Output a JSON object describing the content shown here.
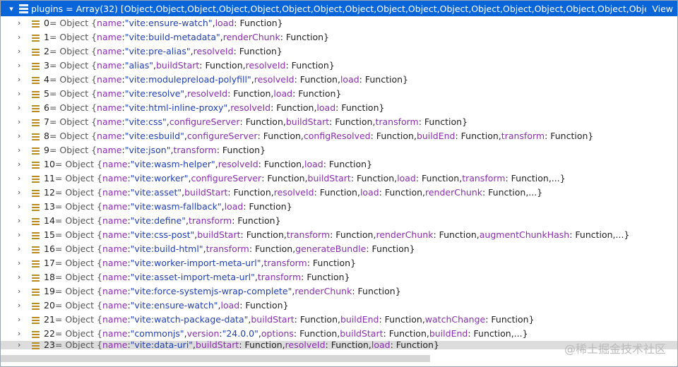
{
  "header": {
    "text": "plugins = Array(32) [Object,Object,Object,Object,Object,Object,Object,Object,Object,Object,Object,Object,Object,Object,Object,Object,Object,Object,Object,Ol...",
    "view_label": "View"
  },
  "rows": [
    {
      "index": "0",
      "parts": [
        [
          "p",
          "name"
        ],
        [
          "k",
          ": "
        ],
        [
          "s",
          "\"vite:ensure-watch\""
        ],
        [
          "k",
          ","
        ],
        [
          "p",
          "load"
        ],
        [
          "f",
          ": Function}"
        ]
      ]
    },
    {
      "index": "1",
      "parts": [
        [
          "p",
          "name"
        ],
        [
          "k",
          ": "
        ],
        [
          "s",
          "\"vite:build-metadata\""
        ],
        [
          "k",
          ","
        ],
        [
          "p",
          "renderChunk"
        ],
        [
          "f",
          ": Function}"
        ]
      ]
    },
    {
      "index": "2",
      "parts": [
        [
          "p",
          "name"
        ],
        [
          "k",
          ": "
        ],
        [
          "s",
          "\"vite:pre-alias\""
        ],
        [
          "k",
          ","
        ],
        [
          "p",
          "resolveId"
        ],
        [
          "f",
          ": Function}"
        ]
      ]
    },
    {
      "index": "3",
      "parts": [
        [
          "p",
          "name"
        ],
        [
          "k",
          ": "
        ],
        [
          "s",
          "\"alias\""
        ],
        [
          "k",
          ","
        ],
        [
          "p",
          "buildStart"
        ],
        [
          "f",
          ": Function,"
        ],
        [
          "p",
          "resolveId"
        ],
        [
          "f",
          ": Function}"
        ]
      ]
    },
    {
      "index": "4",
      "parts": [
        [
          "p",
          "name"
        ],
        [
          "k",
          ": "
        ],
        [
          "s",
          "\"vite:modulepreload-polyfill\""
        ],
        [
          "k",
          ","
        ],
        [
          "p",
          "resolveId"
        ],
        [
          "f",
          ": Function,"
        ],
        [
          "p",
          "load"
        ],
        [
          "f",
          ": Function}"
        ]
      ]
    },
    {
      "index": "5",
      "parts": [
        [
          "p",
          "name"
        ],
        [
          "k",
          ": "
        ],
        [
          "s",
          "\"vite:resolve\""
        ],
        [
          "k",
          ","
        ],
        [
          "p",
          "resolveId"
        ],
        [
          "f",
          ": Function,"
        ],
        [
          "p",
          "load"
        ],
        [
          "f",
          ": Function}"
        ]
      ]
    },
    {
      "index": "6",
      "parts": [
        [
          "p",
          "name"
        ],
        [
          "k",
          ": "
        ],
        [
          "s",
          "\"vite:html-inline-proxy\""
        ],
        [
          "k",
          ","
        ],
        [
          "p",
          "resolveId"
        ],
        [
          "f",
          ": Function,"
        ],
        [
          "p",
          "load"
        ],
        [
          "f",
          ": Function}"
        ]
      ]
    },
    {
      "index": "7",
      "parts": [
        [
          "p",
          "name"
        ],
        [
          "k",
          ": "
        ],
        [
          "s",
          "\"vite:css\""
        ],
        [
          "k",
          ","
        ],
        [
          "p",
          "configureServer"
        ],
        [
          "f",
          ": Function,"
        ],
        [
          "p",
          "buildStart"
        ],
        [
          "f",
          ": Function,"
        ],
        [
          "p",
          "transform"
        ],
        [
          "f",
          ": Function}"
        ]
      ]
    },
    {
      "index": "8",
      "parts": [
        [
          "p",
          "name"
        ],
        [
          "k",
          ": "
        ],
        [
          "s",
          "\"vite:esbuild\""
        ],
        [
          "k",
          ","
        ],
        [
          "p",
          "configureServer"
        ],
        [
          "f",
          ": Function,"
        ],
        [
          "p",
          "configResolved"
        ],
        [
          "f",
          ": Function,"
        ],
        [
          "p",
          "buildEnd"
        ],
        [
          "f",
          ": Function,"
        ],
        [
          "p",
          "transform"
        ],
        [
          "f",
          ": Function}"
        ]
      ]
    },
    {
      "index": "9",
      "parts": [
        [
          "p",
          "name"
        ],
        [
          "k",
          ": "
        ],
        [
          "s",
          "\"vite:json\""
        ],
        [
          "k",
          ","
        ],
        [
          "p",
          "transform"
        ],
        [
          "f",
          ": Function}"
        ]
      ]
    },
    {
      "index": "10",
      "parts": [
        [
          "p",
          "name"
        ],
        [
          "k",
          ": "
        ],
        [
          "s",
          "\"vite:wasm-helper\""
        ],
        [
          "k",
          ","
        ],
        [
          "p",
          "resolveId"
        ],
        [
          "f",
          ": Function,"
        ],
        [
          "p",
          "load"
        ],
        [
          "f",
          ": Function}"
        ]
      ]
    },
    {
      "index": "11",
      "parts": [
        [
          "p",
          "name"
        ],
        [
          "k",
          ": "
        ],
        [
          "s",
          "\"vite:worker\""
        ],
        [
          "k",
          ","
        ],
        [
          "p",
          "configureServer"
        ],
        [
          "f",
          ": Function,"
        ],
        [
          "p",
          "buildStart"
        ],
        [
          "f",
          ": Function,"
        ],
        [
          "p",
          "load"
        ],
        [
          "f",
          ": Function,"
        ],
        [
          "p",
          "transform"
        ],
        [
          "f",
          ": Function,...}"
        ]
      ]
    },
    {
      "index": "12",
      "parts": [
        [
          "p",
          "name"
        ],
        [
          "k",
          ": "
        ],
        [
          "s",
          "\"vite:asset\""
        ],
        [
          "k",
          ","
        ],
        [
          "p",
          "buildStart"
        ],
        [
          "f",
          ": Function,"
        ],
        [
          "p",
          "resolveId"
        ],
        [
          "f",
          ": Function,"
        ],
        [
          "p",
          "load"
        ],
        [
          "f",
          ": Function,"
        ],
        [
          "p",
          "renderChunk"
        ],
        [
          "f",
          ": Function,...}"
        ]
      ]
    },
    {
      "index": "13",
      "parts": [
        [
          "p",
          "name"
        ],
        [
          "k",
          ": "
        ],
        [
          "s",
          "\"vite:wasm-fallback\""
        ],
        [
          "k",
          ","
        ],
        [
          "p",
          "load"
        ],
        [
          "f",
          ": Function}"
        ]
      ]
    },
    {
      "index": "14",
      "parts": [
        [
          "p",
          "name"
        ],
        [
          "k",
          ": "
        ],
        [
          "s",
          "\"vite:define\""
        ],
        [
          "k",
          ","
        ],
        [
          "p",
          "transform"
        ],
        [
          "f",
          ": Function}"
        ]
      ]
    },
    {
      "index": "15",
      "parts": [
        [
          "p",
          "name"
        ],
        [
          "k",
          ": "
        ],
        [
          "s",
          "\"vite:css-post\""
        ],
        [
          "k",
          ","
        ],
        [
          "p",
          "buildStart"
        ],
        [
          "f",
          ": Function,"
        ],
        [
          "p",
          "transform"
        ],
        [
          "f",
          ": Function,"
        ],
        [
          "p",
          "renderChunk"
        ],
        [
          "f",
          ": Function,"
        ],
        [
          "p",
          "augmentChunkHash"
        ],
        [
          "f",
          ": Function,...}"
        ]
      ]
    },
    {
      "index": "16",
      "parts": [
        [
          "p",
          "name"
        ],
        [
          "k",
          ": "
        ],
        [
          "s",
          "\"vite:build-html\""
        ],
        [
          "k",
          ","
        ],
        [
          "p",
          "transform"
        ],
        [
          "f",
          ": Function,"
        ],
        [
          "p",
          "generateBundle"
        ],
        [
          "f",
          ": Function}"
        ]
      ]
    },
    {
      "index": "17",
      "parts": [
        [
          "p",
          "name"
        ],
        [
          "k",
          ": "
        ],
        [
          "s",
          "\"vite:worker-import-meta-url\""
        ],
        [
          "k",
          ","
        ],
        [
          "p",
          "transform"
        ],
        [
          "f",
          ": Function}"
        ]
      ]
    },
    {
      "index": "18",
      "parts": [
        [
          "p",
          "name"
        ],
        [
          "k",
          ": "
        ],
        [
          "s",
          "\"vite:asset-import-meta-url\""
        ],
        [
          "k",
          ","
        ],
        [
          "p",
          "transform"
        ],
        [
          "f",
          ": Function}"
        ]
      ]
    },
    {
      "index": "19",
      "parts": [
        [
          "p",
          "name"
        ],
        [
          "k",
          ": "
        ],
        [
          "s",
          "\"vite:force-systemjs-wrap-complete\""
        ],
        [
          "k",
          ","
        ],
        [
          "p",
          "renderChunk"
        ],
        [
          "f",
          ": Function}"
        ]
      ]
    },
    {
      "index": "20",
      "parts": [
        [
          "p",
          "name"
        ],
        [
          "k",
          ": "
        ],
        [
          "s",
          "\"vite:ensure-watch\""
        ],
        [
          "k",
          ","
        ],
        [
          "p",
          "load"
        ],
        [
          "f",
          ": Function}"
        ]
      ]
    },
    {
      "index": "21",
      "parts": [
        [
          "p",
          "name"
        ],
        [
          "k",
          ": "
        ],
        [
          "s",
          "\"vite:watch-package-data\""
        ],
        [
          "k",
          ","
        ],
        [
          "p",
          "buildStart"
        ],
        [
          "f",
          ": Function,"
        ],
        [
          "p",
          "buildEnd"
        ],
        [
          "f",
          ": Function,"
        ],
        [
          "p",
          "watchChange"
        ],
        [
          "f",
          ": Function}"
        ]
      ]
    },
    {
      "index": "22",
      "parts": [
        [
          "p",
          "name"
        ],
        [
          "k",
          ": "
        ],
        [
          "s",
          "\"commonjs\""
        ],
        [
          "k",
          ","
        ],
        [
          "p",
          "version"
        ],
        [
          "k",
          ": "
        ],
        [
          "s",
          "\"24.0.0\""
        ],
        [
          "k",
          ","
        ],
        [
          "p",
          "options"
        ],
        [
          "f",
          ": Function,"
        ],
        [
          "p",
          "buildStart"
        ],
        [
          "f",
          ": Function,"
        ],
        [
          "p",
          "buildEnd"
        ],
        [
          "f",
          ": Function,...}"
        ]
      ]
    },
    {
      "index": "23",
      "parts": [
        [
          "p",
          "name"
        ],
        [
          "k",
          ": "
        ],
        [
          "s",
          "\"vite:data-uri\""
        ],
        [
          "k",
          ","
        ],
        [
          "p",
          "buildStart"
        ],
        [
          "f",
          ": Function,"
        ],
        [
          "p",
          "resolveId"
        ],
        [
          "f",
          ": Function,"
        ],
        [
          "p",
          "load"
        ],
        [
          "f",
          ": Function}"
        ]
      ]
    }
  ],
  "row_prefix": " = Object {",
  "watermark": "@稀土掘金技术社区"
}
